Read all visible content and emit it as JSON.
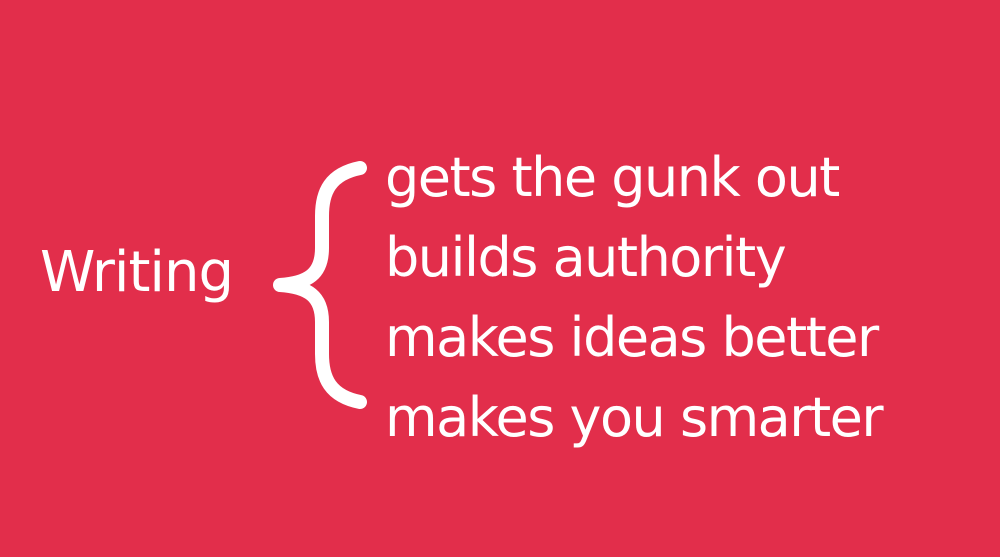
{
  "theme": {
    "background": "#e22e4b",
    "text": "#ffffff"
  },
  "slide": {
    "subject": "Writing",
    "brace_icon": "left-curly-brace",
    "points": [
      "gets the gunk out",
      "builds authority",
      "makes ideas better",
      "makes you smarter"
    ]
  }
}
